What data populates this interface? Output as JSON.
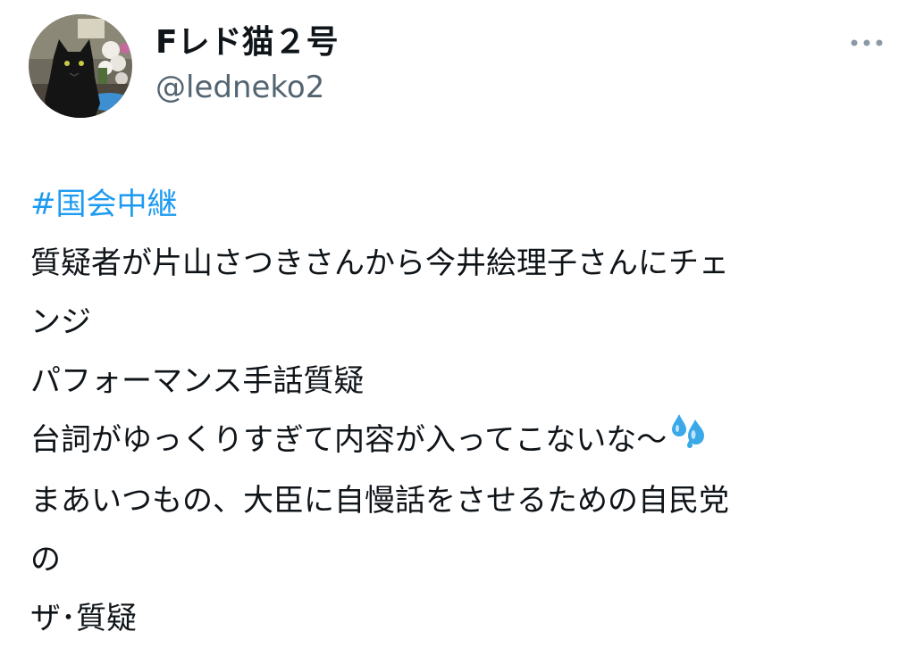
{
  "user": {
    "display_name": "Fレド猫２号",
    "handle": "@ledneko2",
    "avatar_icon": "cat-avatar-icon"
  },
  "more_icon": "more-horizontal-icon",
  "tweet": {
    "hashtag": "#国会中継",
    "lines": [
      "質疑者が片山さつきさんから今井絵理子さんにチェ",
      "ンジ",
      "パフォーマンス手話質疑",
      "台詞がゆっくりすぎて内容が入ってこないな〜",
      "まあいつもの、大臣に自慢話をさせるための自民党",
      "の",
      "ザ･質疑"
    ],
    "emoji_icon": "sweat-droplets-icon"
  },
  "colors": {
    "link": "#1d9bf0",
    "secondary_text": "#536471",
    "primary_text": "#0f1419",
    "emoji": "#3ba8e8"
  }
}
